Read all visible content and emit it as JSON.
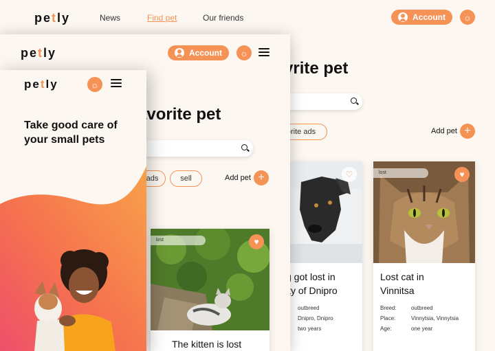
{
  "brand": {
    "pre": "pe",
    "accent": "t",
    "post": "ly",
    "accent_color": "#f59256"
  },
  "desktop": {
    "nav": [
      "News",
      "Find pet",
      "Our friends"
    ],
    "account_label": "Account",
    "title_fragment": "vrite pet",
    "chip_label": "orite ads",
    "add_pet_label": "Add pet",
    "cards": [
      {
        "tag": "",
        "title_line1": "g got lost in",
        "title_line2": "ity of Dnipro",
        "values": [
          "outbreed",
          "Dnipro, Dnipro",
          "two years"
        ]
      },
      {
        "tag": "lost",
        "title_line1": "Lost cat in",
        "title_line2": "Vinnitsa",
        "labels": [
          "Breed:",
          "Place:",
          "Age:"
        ],
        "values": [
          "outbreed",
          "Vinnytsia, Vinnytsia",
          "one year"
        ]
      }
    ]
  },
  "tablet": {
    "account_label": "Account",
    "title_fragment": "avorite pet",
    "chip_left": "ads",
    "chip_sell": "sell",
    "add_pet_label": "Add pet",
    "card": {
      "tag": "lost",
      "title": "The kitten is lost"
    }
  },
  "mobile": {
    "hero_line1": "Take good care of",
    "hero_line2": "your small pets"
  },
  "icons": {
    "theme": "sun-icon",
    "menu": "hamburger-icon",
    "search": "search-icon",
    "favorite": "heart-icon",
    "add": "plus-icon",
    "user": "user-icon"
  }
}
